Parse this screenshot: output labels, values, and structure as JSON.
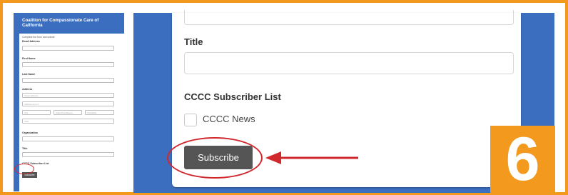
{
  "thumbnail": {
    "title": "Coalition for Compassionate Care of California",
    "intro": "Complete the form and submit",
    "fields": [
      {
        "label": "Email Address",
        "placeholder": ""
      },
      {
        "label": "First Name",
        "placeholder": ""
      },
      {
        "label": "Last Name",
        "placeholder": ""
      },
      {
        "label": "Address",
        "placeholder": "Street Address"
      }
    ],
    "address_line2": "Address Line 2",
    "city": "City",
    "state": "State/Prov/Region",
    "zip": "Postal/Zip",
    "country": "USA",
    "organization_label": "Organization",
    "title_label": "Title",
    "list_label": "CCCC Subscriber List",
    "subscribe_label": "Subscribe"
  },
  "form": {
    "title_label": "Title",
    "title_value": "",
    "list_label": "CCCC Subscriber List",
    "list_option": "CCCC News",
    "list_option_checked": false,
    "subscribe_label": "Subscribe"
  },
  "step_number": "6",
  "colors": {
    "frame": "#f39a1e",
    "panel": "#3c6ebf",
    "highlight": "#d1282e",
    "button": "#555555"
  }
}
